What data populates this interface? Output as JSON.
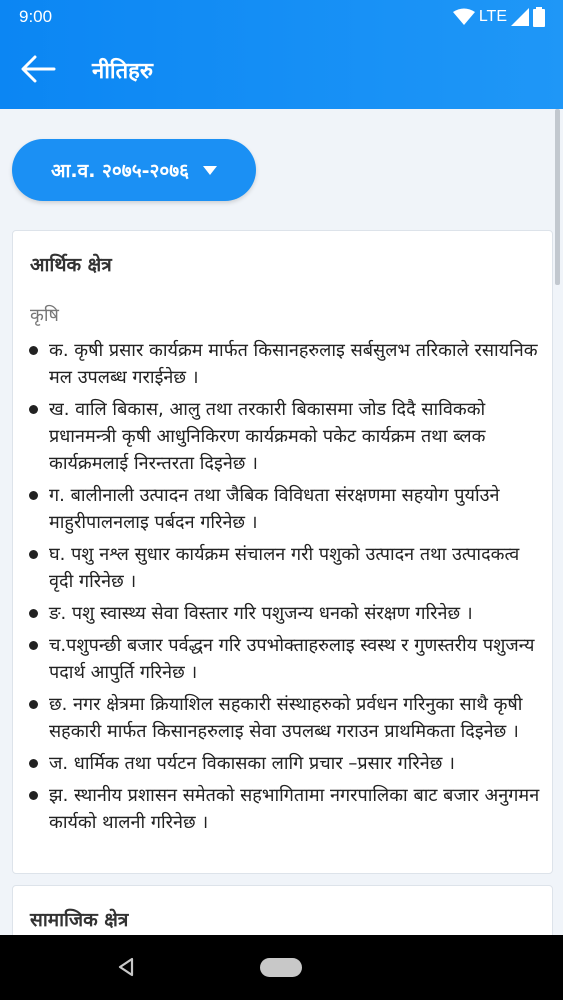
{
  "status_bar": {
    "time": "9:00",
    "network": "LTE",
    "icons": [
      "wifi-icon",
      "signal-icon",
      "battery-icon"
    ]
  },
  "header": {
    "title": "नीतिहरु",
    "back_icon": "arrow-left-icon"
  },
  "year_selector": {
    "label": "आ.व. २०७५-२०७६",
    "icon": "dropdown-triangle-icon"
  },
  "sections": [
    {
      "title": "आर्थिक क्षेत्र",
      "subcategory": "कृषि",
      "items": [
        "क.  कृषी प्रसार कार्यक्रम मार्फत किसानहरुलाइ सर्बसुलभ तरिकाले रसायनिक मल उपलब्ध गराईनेछ ।",
        "ख.  वालि बिकास, आलु तथा तरकारी बिकासमा जोड दिदै साविकको प्रधानमन्त्री कृषी आधुनिकिरण कार्यक्रमको पकेट कार्यक्रम तथा ब्लक कार्यक्रमलाई निरन्तरता दिइनेछ ।",
        "ग.  बालीनाली उत्पादन तथा जैबिक विविधता संरक्षणमा सहयोग पुर्याउने माहुरीपालनलाइ पर्बदन गरिनेछ ।",
        "घ. पशु नश्ल सुधार कार्यक्रम संचालन गरी पशुको उत्पादन तथा उत्पादकत्व वृदी गरिनेछ ।",
        "ङ.  पशु स्वास्थ्य सेवा विस्तार गरि पशुजन्य धनको संरक्षण गरिनेछ ।",
        "च.पशुपन्छी बजार पर्वद्धन गरि उपभोक्ताहरुलाइ स्वस्थ र गुणस्तरीय पशुजन्य पदार्थ आपुर्ति गरिनेछ ।",
        "छ.  नगर क्षेत्रमा क्रियाशिल सहकारी संस्थाहरुको प्रर्वधन गरिनुका साथै कृषी सहकारी मार्फत किसानहरुलाइ सेवा उपलब्ध गराउन प्राथमिकता दिइनेछ ।",
        "ज.   धार्मिक तथा पर्यटन विकासका लागि प्रचार –प्रसार गरिनेछ ।",
        "झ.  स्थानीय प्रशासन समेतको सहभागितामा नगरपालिका बाट बजार अनुगमन कार्यको थालनी गरिनेछ ।"
      ]
    },
    {
      "title": "सामाजिक क्षेत्र"
    }
  ],
  "nav_bar": {
    "back_icon": "nav-back-icon",
    "home_icon": "nav-home-pill-icon"
  }
}
